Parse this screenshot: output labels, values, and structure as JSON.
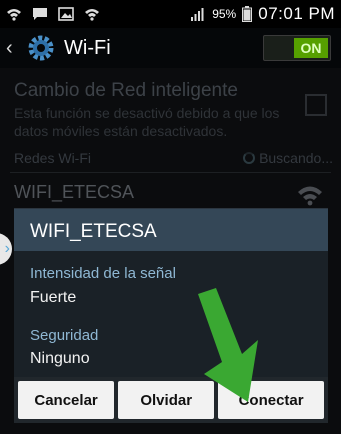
{
  "status_bar": {
    "battery_percent": "95%",
    "time": "07:01 PM",
    "icons": [
      "wifi-icon",
      "message-icon",
      "image-icon",
      "wifi-icon",
      "signal-icon",
      "battery-icon"
    ]
  },
  "action_bar": {
    "title": "Wi-Fi",
    "toggle_label": "ON",
    "icons": [
      "back-icon",
      "gear-icon"
    ]
  },
  "background": {
    "smart_network_title": "Cambio de Red inteligente",
    "smart_network_desc": "Esta función se desactivó debido a que los datos móviles están desactivados.",
    "section_label": "Redes Wi-Fi",
    "search_status": "Buscando...",
    "network_name": "WIFI_ETECSA"
  },
  "dialog": {
    "title": "WIFI_ETECSA",
    "signal_label": "Intensidad de la señal",
    "signal_value": "Fuerte",
    "security_label": "Seguridad",
    "security_value": "Ninguno",
    "buttons": {
      "cancel": "Cancelar",
      "forget": "Olvidar",
      "connect": "Conectar"
    }
  },
  "colors": {
    "dialog_header": "#344757",
    "label_blue": "#8fb8d4",
    "toggle_green": "#56a000",
    "arrow_green": "#3aa832"
  }
}
